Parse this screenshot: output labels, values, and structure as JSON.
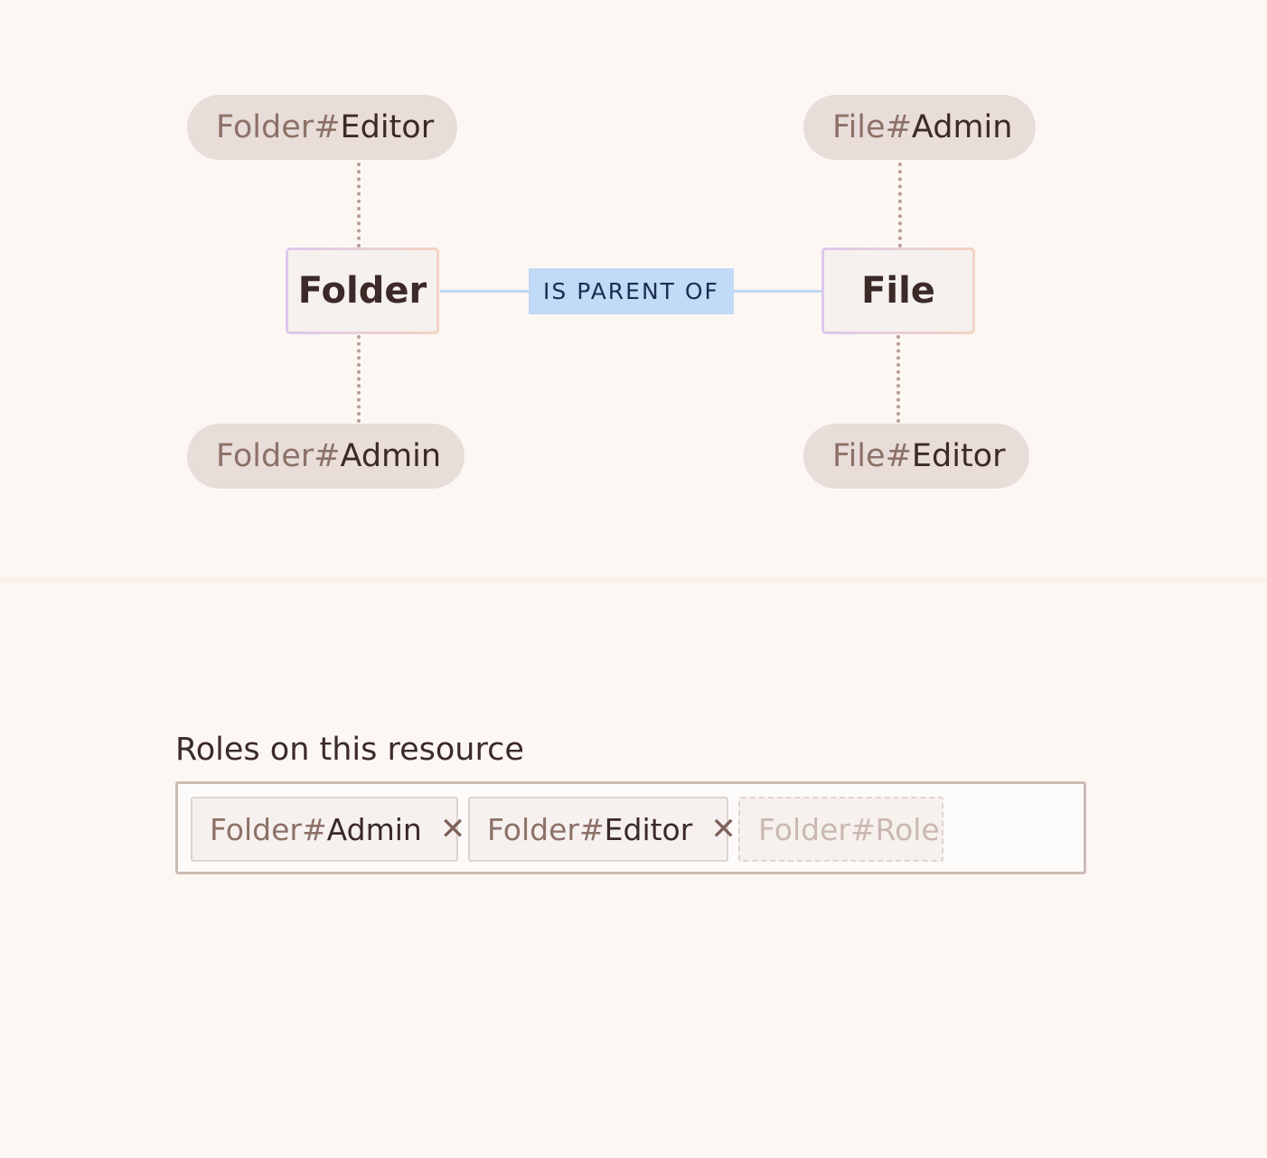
{
  "diagram": {
    "left_entity": {
      "label": "Folder",
      "top_role": {
        "ns": "Folder#",
        "role": "Editor"
      },
      "bottom_role": {
        "ns": "Folder#",
        "role": "Admin"
      }
    },
    "relation_label": "IS PARENT OF",
    "right_entity": {
      "label": "File",
      "top_role": {
        "ns": "File#",
        "role": "Admin"
      },
      "bottom_role": {
        "ns": "File#",
        "role": "Editor"
      }
    },
    "colors": {
      "background": "#fdf7f4",
      "pill": "#e8ddd8",
      "relation": "#c1daf5",
      "connector": "#b79d94"
    }
  },
  "roles": {
    "title": "Roles on this resource",
    "chips": [
      {
        "ns": "Folder#",
        "role": "Admin",
        "remove": "✕"
      },
      {
        "ns": "Folder#",
        "role": "Editor",
        "remove": "✕"
      }
    ],
    "placeholder": "Folder#Role"
  }
}
